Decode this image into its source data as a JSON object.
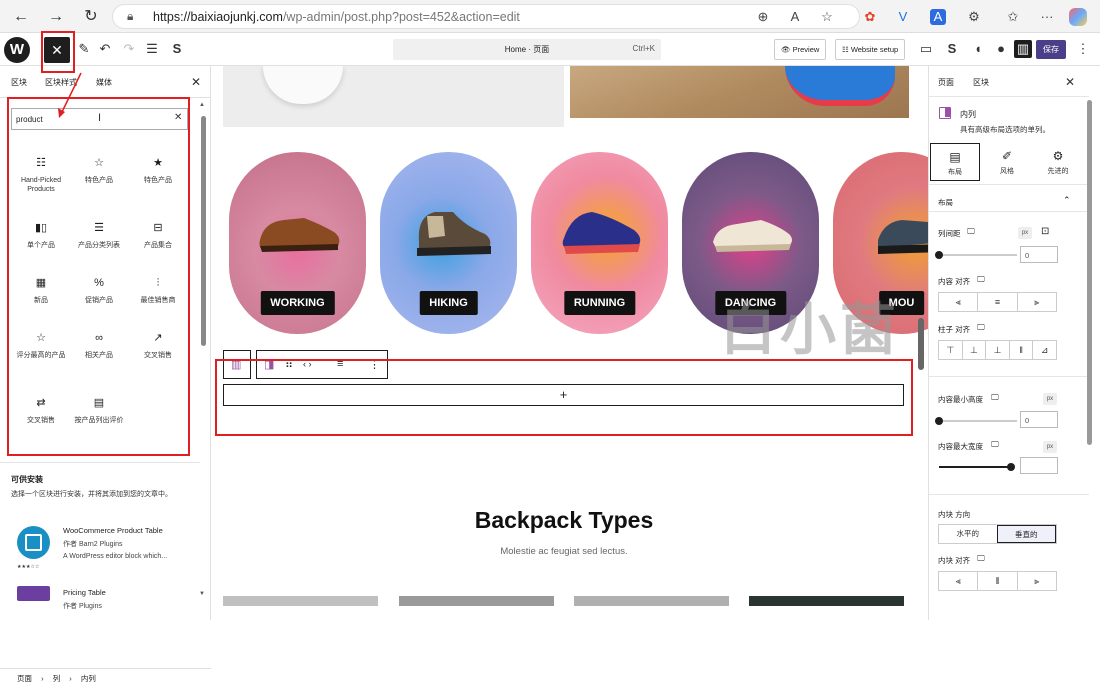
{
  "browser": {
    "url_host": "https://baixiaojunkj.com",
    "url_path": "/wp-admin/post.php?post=452&action=edit"
  },
  "toolbar": {
    "command_label": "Home · 页面",
    "command_shortcut": "Ctrl+K",
    "preview_label": "Preview",
    "website_setup_label": "Website setup",
    "save_label": "保存"
  },
  "left_panel": {
    "tabs": [
      "区块",
      "区块样式",
      "媒体"
    ],
    "search_value": "product",
    "blocks": [
      {
        "icon": "☷",
        "label": "Hand-Picked Products"
      },
      {
        "icon": "☆",
        "label": "特色产品"
      },
      {
        "icon": "★",
        "label": "特色产品"
      },
      {
        "icon": "▮▯",
        "label": "单个产品"
      },
      {
        "icon": "☰",
        "label": "产品分类列表"
      },
      {
        "icon": "⊟",
        "label": "产品集合"
      },
      {
        "icon": "▦",
        "label": "新品"
      },
      {
        "icon": "%",
        "label": "促销产品"
      },
      {
        "icon": "⫶",
        "label": "最佳销售商"
      },
      {
        "icon": "☆",
        "label": "评分最高的产品"
      },
      {
        "icon": "∞",
        "label": "相关产品"
      },
      {
        "icon": "↗",
        "label": "交叉销售"
      },
      {
        "icon": "⇄",
        "label": "交叉销售"
      },
      {
        "icon": "▤",
        "label": "按产品列出评价"
      }
    ],
    "available_title": "可供安装",
    "available_desc": "选择一个区块进行安装，并将其添加到您的文章中。",
    "plugins": [
      {
        "name": "WooCommerce Product Table",
        "author": "作者 Barn2 Plugins",
        "desc": "A WordPress editor block which...",
        "stars": "★★★☆☆"
      },
      {
        "name": "Pricing Table",
        "author": "作者 Plugins",
        "desc": "",
        "stars": ""
      }
    ],
    "breadcrumb": [
      "页面",
      "列",
      "内列"
    ]
  },
  "canvas": {
    "cards": [
      {
        "label": "WORKING"
      },
      {
        "label": "HIKING"
      },
      {
        "label": "RUNNING"
      },
      {
        "label": "DANCING"
      },
      {
        "label": "MOU"
      }
    ],
    "watermark": "白小菌",
    "add_symbol": "+",
    "section_title": "Backpack Types",
    "section_subtitle": "Molestie ac feugiat sed lectus."
  },
  "right_panel": {
    "tabs": [
      "页面",
      "区块"
    ],
    "block_name": "内列",
    "block_desc": "具有高级布局选项的单列。",
    "icon_tabs": [
      "布局",
      "风格",
      "先进的"
    ],
    "section_layout": "布局",
    "column_gap_label": "列间距",
    "column_gap_value": "0",
    "unit_px": "px",
    "content_align_label": "内容 对齐",
    "column_align_label": "柱子 对齐",
    "min_height_label": "内容最小高度",
    "min_height_value": "0",
    "max_width_label": "内容最大宽度",
    "max_width_value": "",
    "direction_label": "内块 方向",
    "direction_options": [
      "水平的",
      "垂直的"
    ],
    "inner_align_label": "内块 对齐"
  },
  "colors": {
    "highlight_red": "#e02020",
    "save_purple": "#4b3f8a"
  }
}
